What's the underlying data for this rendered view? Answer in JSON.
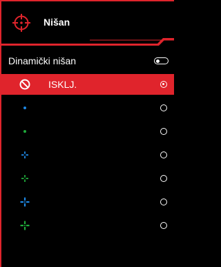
{
  "header": {
    "title": "Nišan",
    "icon": "crosshair-icon"
  },
  "dynamic_crosshair": {
    "label": "Dinamički nišan",
    "enabled": false
  },
  "colors": {
    "accent": "#e0242c",
    "blue": "#1e88e5",
    "green": "#1faa3a"
  },
  "options": [
    {
      "label": "ISKLJ.",
      "icon": "off-icon",
      "selected": true
    },
    {
      "label": "",
      "icon": "dot-small-blue-icon",
      "selected": false
    },
    {
      "label": "",
      "icon": "dot-small-green-icon",
      "selected": false
    },
    {
      "label": "",
      "icon": "crosshair-small-blue-icon",
      "selected": false
    },
    {
      "label": "",
      "icon": "crosshair-small-green-icon",
      "selected": false
    },
    {
      "label": "",
      "icon": "cross-blue-icon",
      "selected": false
    },
    {
      "label": "",
      "icon": "cross-green-icon",
      "selected": false
    }
  ]
}
